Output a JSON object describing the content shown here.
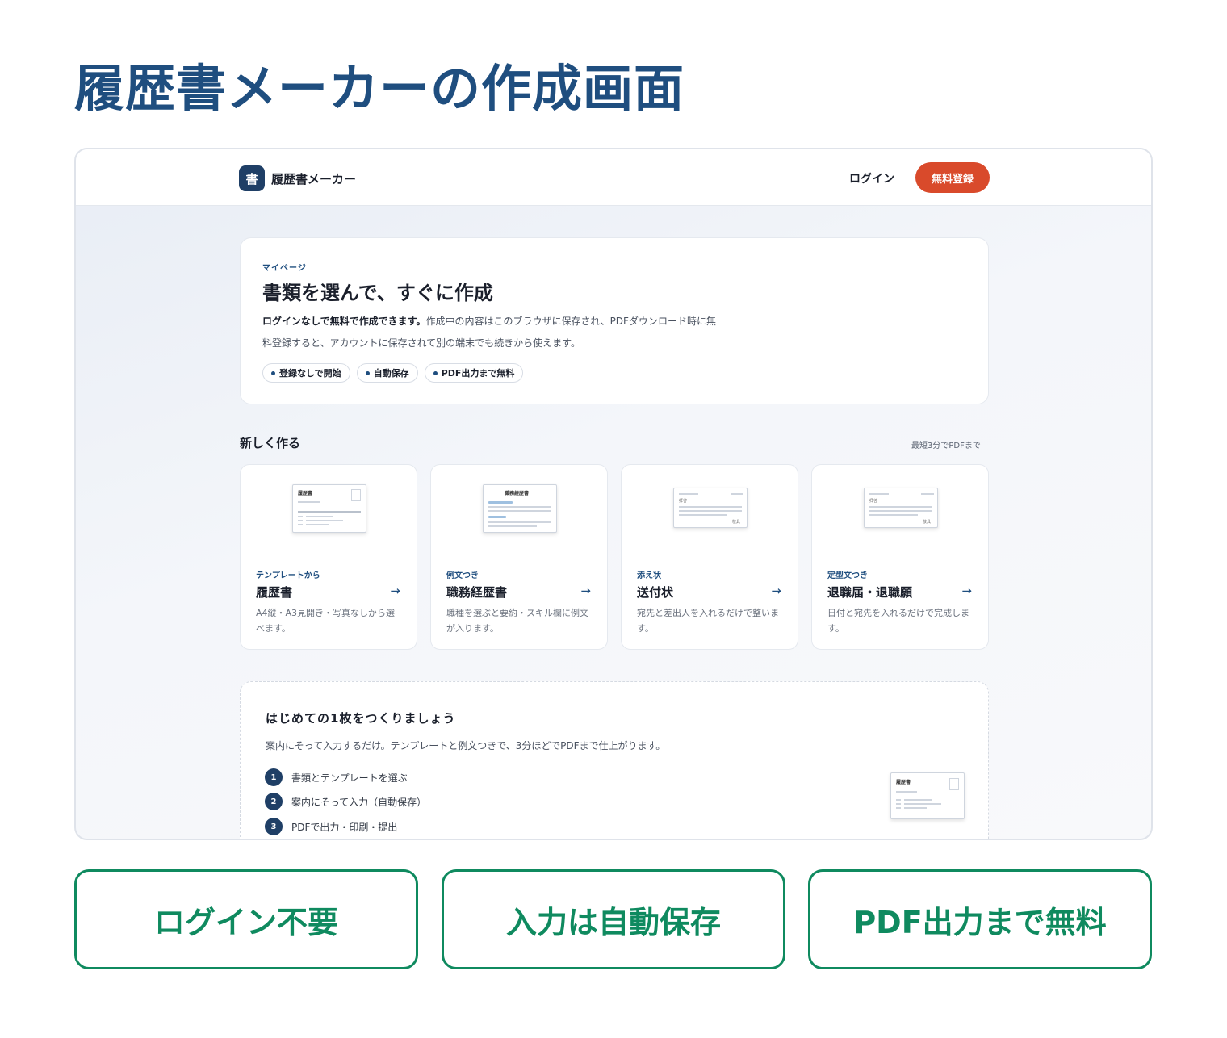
{
  "page": {
    "title": "履歴書メーカーの作成画面"
  },
  "app": {
    "logo_glyph": "書",
    "name": "履歴書メーカー",
    "login_label": "ログイン",
    "signup_label": "無料登録"
  },
  "hero": {
    "eyebrow": "マイページ",
    "title": "書類を選んで、すぐに作成",
    "desc_bold": "ログインなしで無料で作成できます。",
    "desc_rest": "作成中の内容はこのブラウザに保存され、PDFダウンロード時に無料登録すると、アカウントに保存されて別の端末でも続きから使えます。",
    "chips": [
      "登録なしで開始",
      "自動保存",
      "PDF出力まで無料"
    ]
  },
  "new_section": {
    "title": "新しく作る",
    "note": "最短3分でPDFまで"
  },
  "cards": [
    {
      "eyebrow": "テンプレートから",
      "title": "履歴書",
      "arrow": "→",
      "desc": "A4縦・A3見開き・写真なしから選べます。",
      "thumb_title": "履歴書"
    },
    {
      "eyebrow": "例文つき",
      "title": "職務経歴書",
      "arrow": "→",
      "desc": "職種を選ぶと要約・スキル欄に例文が入ります。",
      "thumb_title": "職務経歴書"
    },
    {
      "eyebrow": "添え状",
      "title": "送付状",
      "arrow": "→",
      "desc": "宛先と差出人を入れるだけで整います。",
      "thumb_title": "拝啓",
      "thumb_sign": "敬具"
    },
    {
      "eyebrow": "定型文つき",
      "title": "退職届・退職願",
      "arrow": "→",
      "desc": "日付と宛先を入れるだけで完成します。",
      "thumb_title": "拝啓",
      "thumb_sign": "敬具"
    }
  ],
  "first": {
    "title": "はじめての1枚をつくりましょう",
    "desc": "案内にそって入力するだけ。テンプレートと例文つきで、3分ほどでPDFまで仕上がります。",
    "steps": [
      {
        "num": "1",
        "label": "書類とテンプレートを選ぶ"
      },
      {
        "num": "2",
        "label": "案内にそって入力（自動保存）"
      },
      {
        "num": "3",
        "label": "PDFで出力・印刷・提出"
      }
    ],
    "thumb_title": "履歴書"
  },
  "features": [
    "ログイン不要",
    "入力は自動保存",
    "PDF出力まで無料"
  ],
  "colors": {
    "title_blue": "#1f4e7f",
    "accent_red": "#d94a2b",
    "feature_green": "#0f8a5f",
    "navy": "#1f3f66"
  }
}
